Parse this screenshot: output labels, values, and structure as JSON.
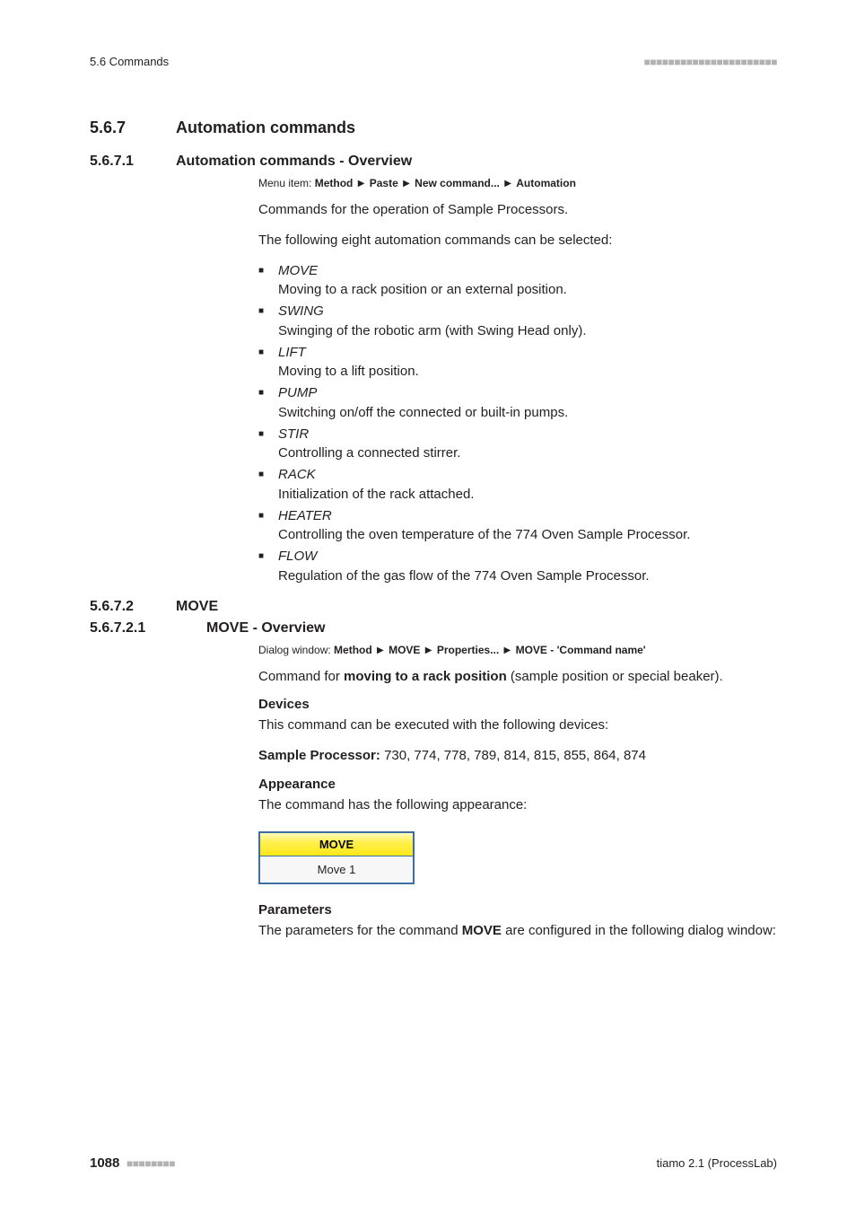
{
  "header": {
    "section_ref": "5.6 Commands",
    "dots": "■■■■■■■■■■■■■■■■■■■■■■"
  },
  "h1": {
    "num": "5.6.7",
    "title": "Automation commands"
  },
  "h2a": {
    "num": "5.6.7.1",
    "title": "Automation commands - Overview"
  },
  "menu1": {
    "label": "Menu item: ",
    "parts": [
      "Method",
      "Paste",
      "New command...",
      "Automation"
    ]
  },
  "intro1": "Commands for the operation of Sample Processors.",
  "intro2": "The following eight automation commands can be selected:",
  "cmds": [
    {
      "name": "MOVE",
      "desc": "Moving to a rack position or an external position."
    },
    {
      "name": "SWING",
      "desc": "Swinging of the robotic arm (with Swing Head only)."
    },
    {
      "name": "LIFT",
      "desc": "Moving to a lift position."
    },
    {
      "name": "PUMP",
      "desc": "Switching on/off the connected or built-in pumps."
    },
    {
      "name": "STIR",
      "desc": "Controlling a connected stirrer."
    },
    {
      "name": "RACK",
      "desc": "Initialization of the rack attached."
    },
    {
      "name": "HEATER",
      "desc": "Controlling the oven temperature of the 774 Oven Sample Processor."
    },
    {
      "name": "FLOW",
      "desc": "Regulation of the gas flow of the 774 Oven Sample Processor."
    }
  ],
  "h2b": {
    "num": "5.6.7.2",
    "title": "MOVE"
  },
  "h3": {
    "num": "5.6.7.2.1",
    "title": "MOVE - Overview"
  },
  "menu2": {
    "label": "Dialog window: ",
    "parts": [
      "Method",
      "MOVE",
      "Properties...",
      "MOVE - 'Command name'"
    ]
  },
  "move_para_pre": "Command for ",
  "move_para_bold": "moving to a rack position",
  "move_para_post": " (sample position or special beaker).",
  "devices": {
    "heading": "Devices",
    "line": "This command can be executed with the following devices:",
    "proc_label": "Sample Processor:",
    "proc_values": " 730, 774, 778, 789, 814, 815, 855, 864, 874"
  },
  "appearance": {
    "heading": "Appearance",
    "line": "The command has the following appearance:",
    "box_title": "MOVE",
    "box_body": "Move 1"
  },
  "params": {
    "heading": "Parameters",
    "line_pre": "The parameters for the command ",
    "line_bold": "MOVE",
    "line_post": " are configured in the following dialog window:"
  },
  "footer": {
    "page": "1088",
    "dots": "■■■■■■■■",
    "product": "tiamo 2.1 (ProcessLab)"
  }
}
